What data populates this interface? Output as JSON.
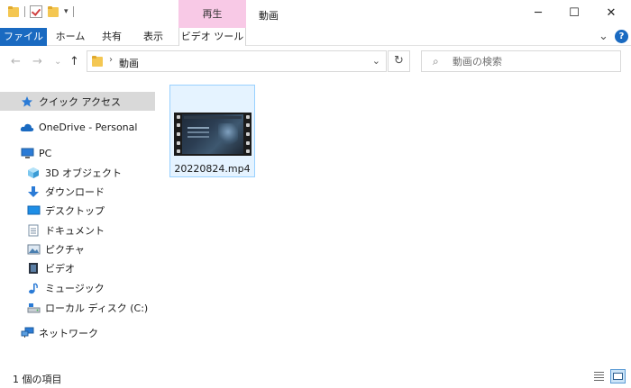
{
  "window": {
    "title": "動画",
    "context_tab_header": "再生",
    "minimize": "─",
    "maximize": "☐",
    "close": "✕"
  },
  "ribbon": {
    "tabs": [
      "ファイル",
      "ホーム",
      "共有",
      "表示",
      "ビデオ ツール"
    ],
    "collapse_chevron": "⌄",
    "help": "?"
  },
  "nav": {
    "back": "←",
    "forward": "→",
    "recent": "⌄",
    "up": "↑"
  },
  "address": {
    "separator": "›",
    "path": "動画",
    "dropdown": "⌄",
    "refresh": "↻"
  },
  "search": {
    "placeholder": "動画の検索",
    "value": ""
  },
  "sidebar": {
    "items": [
      {
        "label": "クイック アクセス",
        "icon": "star-icon"
      },
      {
        "label": "OneDrive - Personal",
        "icon": "cloud-icon"
      },
      {
        "label": "PC",
        "icon": "pc-icon"
      },
      {
        "label": "3D オブジェクト",
        "icon": "cube-icon"
      },
      {
        "label": "ダウンロード",
        "icon": "download-icon"
      },
      {
        "label": "デスクトップ",
        "icon": "desktop-icon"
      },
      {
        "label": "ドキュメント",
        "icon": "document-icon"
      },
      {
        "label": "ピクチャ",
        "icon": "picture-icon"
      },
      {
        "label": "ビデオ",
        "icon": "video-icon"
      },
      {
        "label": "ミュージック",
        "icon": "music-icon"
      },
      {
        "label": "ローカル ディスク (C:)",
        "icon": "drive-icon"
      },
      {
        "label": "ネットワーク",
        "icon": "network-icon"
      }
    ]
  },
  "files": [
    {
      "name": "20220824.mp4",
      "icon": "video-thumbnail-icon"
    }
  ],
  "status": {
    "item_count": "1 個の項目"
  },
  "colors": {
    "accent": "#1a6ac1",
    "context_tab": "#f8c9e6",
    "selection": "#cce4f7",
    "folder": "#f4c752"
  }
}
